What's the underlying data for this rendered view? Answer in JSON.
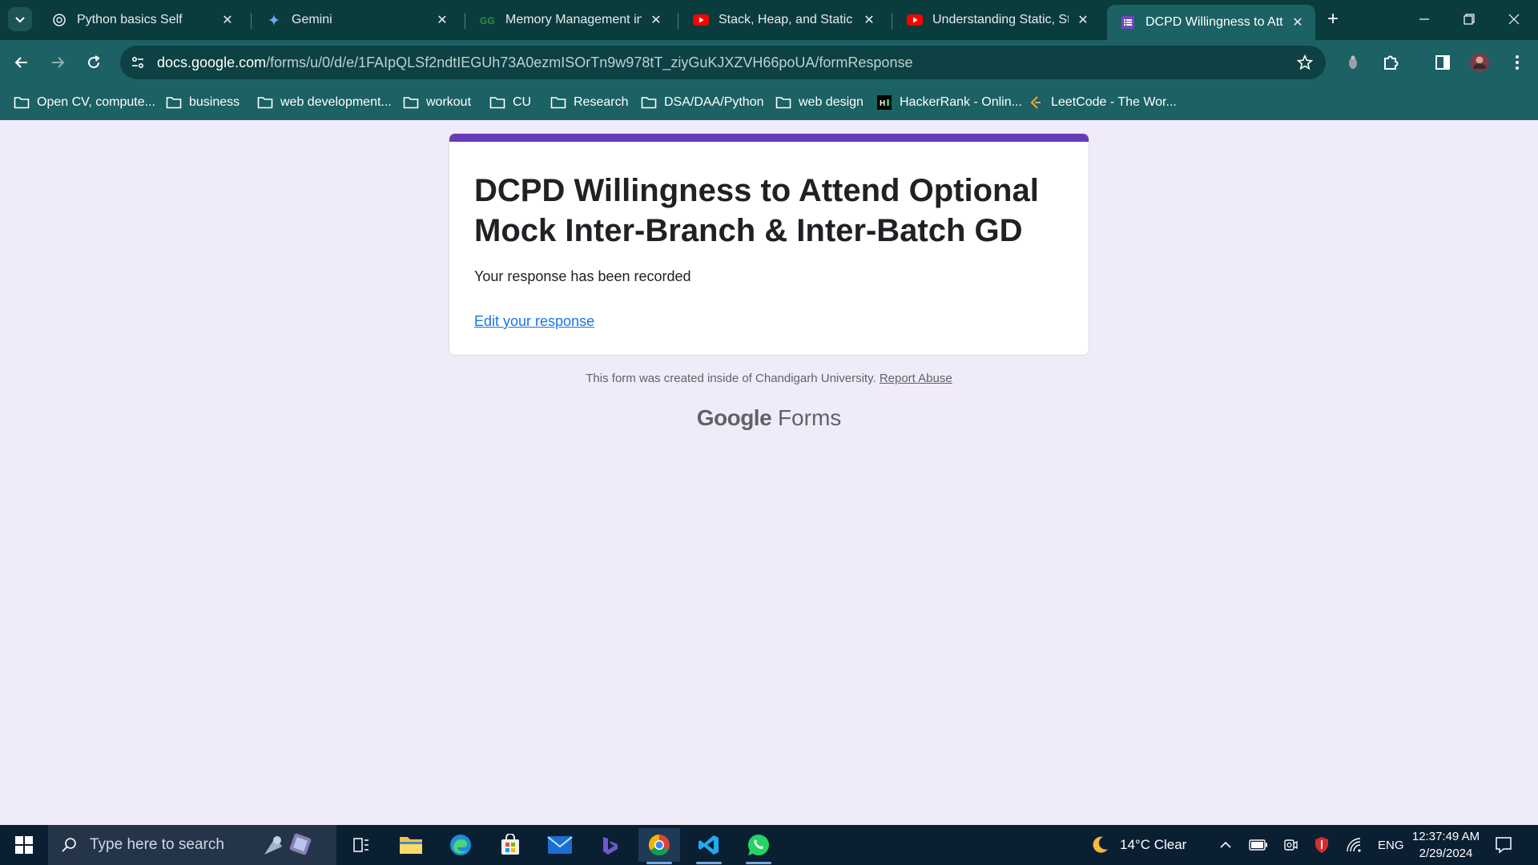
{
  "browser": {
    "tabs": [
      {
        "title": "Python basics Self",
        "favicon": "openai-icon"
      },
      {
        "title": "Gemini",
        "favicon": "gemini-icon"
      },
      {
        "title": "Memory Management in P",
        "favicon": "geeksforgeeks-icon"
      },
      {
        "title": "Stack, Heap, and Static Mem",
        "favicon": "youtube-icon"
      },
      {
        "title": "Understanding Static, Stack",
        "favicon": "youtube-icon"
      },
      {
        "title": "DCPD Willingness to Atten",
        "favicon": "google-forms-icon",
        "active": true
      }
    ],
    "url_host": "docs.google.com",
    "url_path": "/forms/u/0/d/e/1FAIpQLSf2ndtIEGUh73A0ezmISOrTn9w978tT_ziyGuKJXZVH66poUA/formResponse",
    "bookmarks": [
      {
        "label": "Open CV, compute...",
        "icon": "folder-icon"
      },
      {
        "label": "business",
        "icon": "folder-icon"
      },
      {
        "label": "web development...",
        "icon": "folder-icon"
      },
      {
        "label": "workout",
        "icon": "folder-icon"
      },
      {
        "label": "CU",
        "icon": "folder-icon"
      },
      {
        "label": "Research",
        "icon": "folder-icon"
      },
      {
        "label": "DSA/DAA/Python",
        "icon": "folder-icon"
      },
      {
        "label": "web design",
        "icon": "folder-icon"
      },
      {
        "label": "HackerRank - Onlin...",
        "icon": "hackerrank-icon"
      },
      {
        "label": "LeetCode - The Wor...",
        "icon": "leetcode-icon"
      }
    ]
  },
  "form": {
    "title": "DCPD Willingness to Attend Optional Mock Inter-Branch & Inter-Batch GD",
    "confirmation": "Your response has been recorded",
    "edit_link": "Edit your response",
    "accent_color": "#673ab7"
  },
  "footer": {
    "note": "This form was created inside of Chandigarh University.",
    "report_link": "Report Abuse",
    "brand_google": "Google",
    "brand_forms": "Forms"
  },
  "taskbar": {
    "search_placeholder": "Type here to search",
    "weather": "14°C  Clear",
    "language": "ENG",
    "time": "12:37:49 AM",
    "date": "2/29/2024"
  },
  "colors": {
    "page_bg": "#f0ebf8",
    "chrome_dark": "#0b3c3d",
    "chrome": "#1c6163",
    "link": "#1a73e8"
  }
}
